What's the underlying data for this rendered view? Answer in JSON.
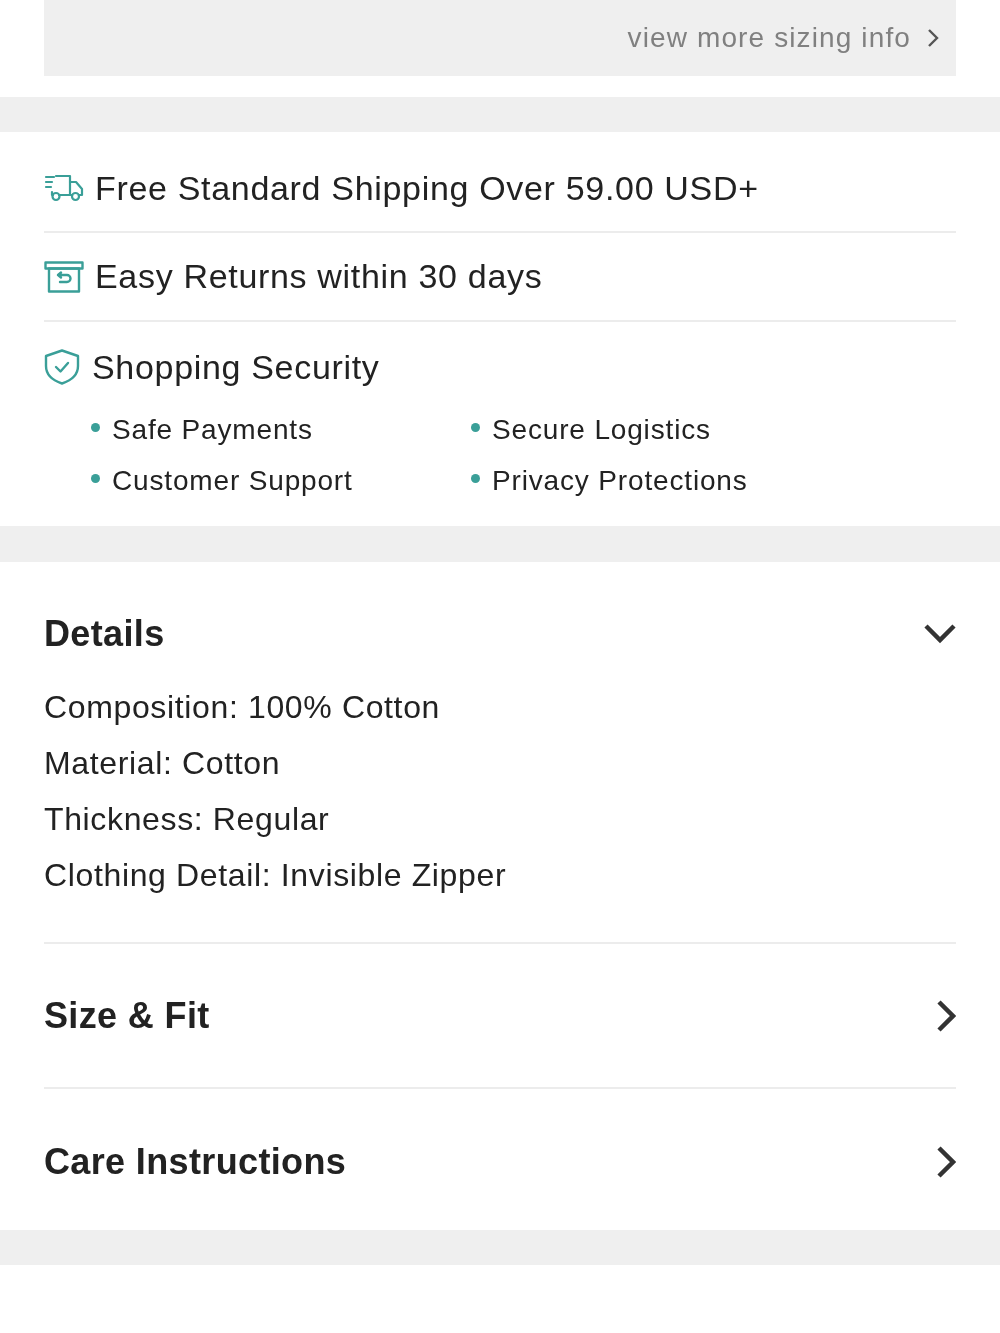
{
  "sizing_link": {
    "label": "view more sizing info"
  },
  "services": [
    {
      "kind": "shipping",
      "text": "Free Standard Shipping Over 59.00 USD+"
    },
    {
      "kind": "returns",
      "text": "Easy Returns within 30 days"
    },
    {
      "kind": "security",
      "text": "Shopping Security",
      "items": [
        "Safe Payments",
        "Secure Logistics",
        "Customer Support",
        "Privacy Protections"
      ]
    }
  ],
  "sections": [
    {
      "title": "Details",
      "expanded": true,
      "lines": [
        "Composition: 100% Cotton",
        "Material: Cotton",
        "Thickness: Regular",
        "Clothing Detail: Invisible Zipper"
      ]
    },
    {
      "title": "Size & Fit",
      "expanded": false
    },
    {
      "title": "Care Instructions",
      "expanded": false
    }
  ]
}
